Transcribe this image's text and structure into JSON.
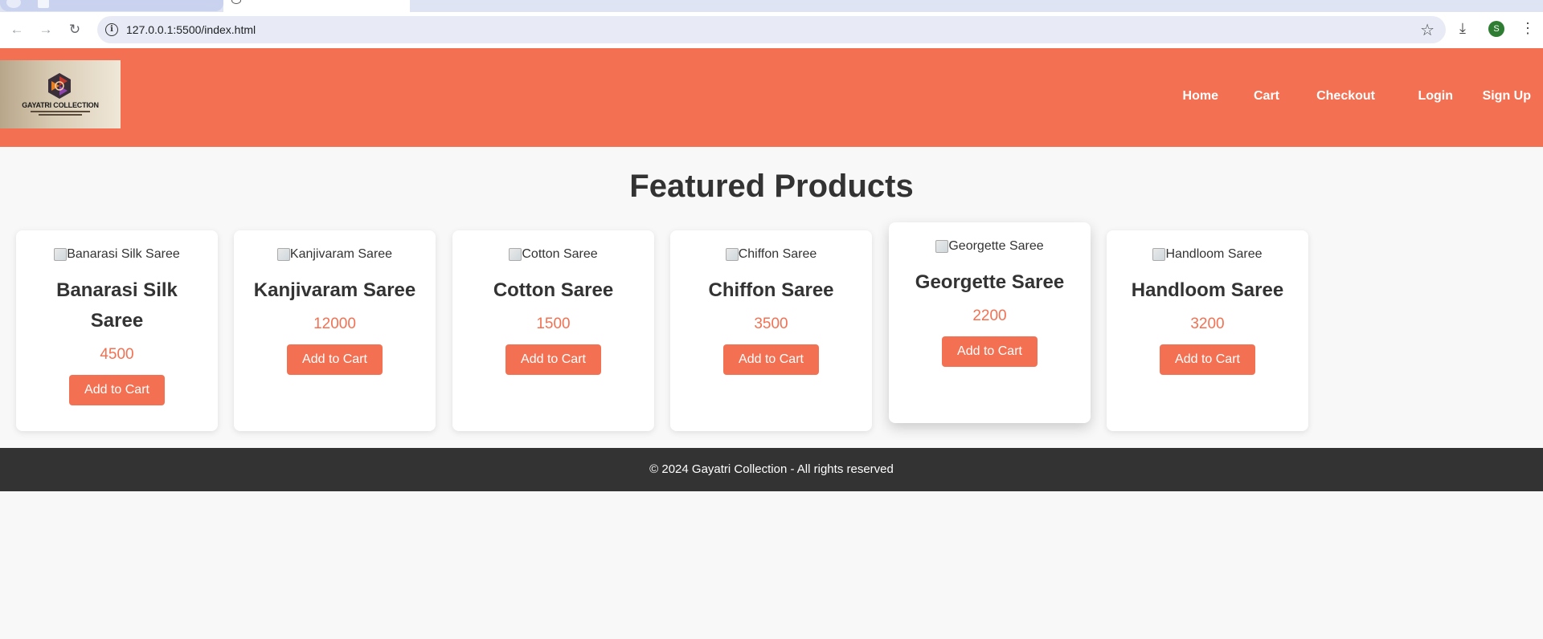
{
  "browser": {
    "url": "127.0.0.1:5500/index.html",
    "avatar_letter": "S"
  },
  "logo": {
    "name": "GAYATRI COLLECTION"
  },
  "nav": [
    {
      "label": "Home"
    },
    {
      "label": "Cart"
    },
    {
      "label": "Checkout"
    },
    {
      "label": "Login"
    },
    {
      "label": "Sign Up"
    }
  ],
  "main": {
    "heading": "Featured Products",
    "products": [
      {
        "alt": "Banarasi Silk Saree",
        "name": "Banarasi Silk Saree",
        "price": "4500",
        "button": "Add to Cart"
      },
      {
        "alt": "Kanjivaram Saree",
        "name": "Kanjivaram Saree",
        "price": "12000",
        "button": "Add to Cart"
      },
      {
        "alt": "Cotton Saree",
        "name": "Cotton Saree",
        "price": "1500",
        "button": "Add to Cart"
      },
      {
        "alt": "Chiffon Saree",
        "name": "Chiffon Saree",
        "price": "3500",
        "button": "Add to Cart"
      },
      {
        "alt": "Georgette Saree",
        "name": "Georgette Saree",
        "price": "2200",
        "button": "Add to Cart"
      },
      {
        "alt": "Handloom Saree",
        "name": "Handloom Saree",
        "price": "3200",
        "button": "Add to Cart"
      }
    ]
  },
  "footer": {
    "text": "© 2024 Gayatri Collection - All rights reserved"
  },
  "colors": {
    "accent": "#f37152",
    "footer_bg": "#333333",
    "page_bg": "#f8f8f8"
  }
}
